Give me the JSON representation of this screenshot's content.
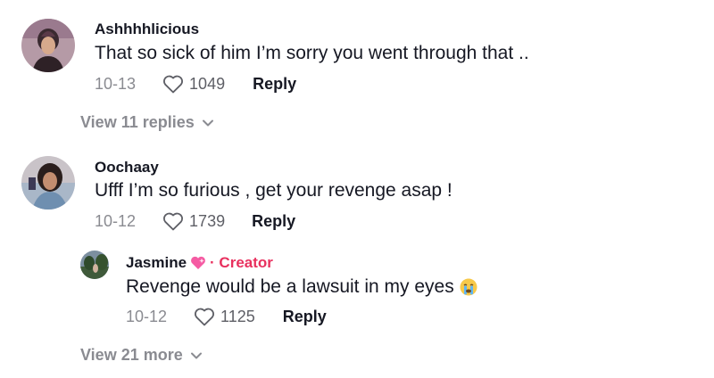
{
  "comments": [
    {
      "username": "Ashhhhlicious",
      "text": "That so sick of him I’m sorry you went through that ..",
      "date": "10-13",
      "likes": "1049",
      "reply_label": "Reply"
    },
    {
      "username": "Oochaay",
      "text": "Ufff I’m so furious , get your revenge asap !",
      "date": "10-12",
      "likes": "1739",
      "reply_label": "Reply"
    }
  ],
  "view_replies_1": "View 11 replies",
  "nested_reply": {
    "username": "Jasmine",
    "creator_label": "· Creator",
    "text": "Revenge would be a lawsuit in my eyes",
    "date": "10-12",
    "likes": "1125",
    "reply_label": "Reply"
  },
  "view_more": "View 21 more",
  "colors": {
    "text": "#161823",
    "muted": "#8a8b91",
    "creator": "#e8305e"
  }
}
